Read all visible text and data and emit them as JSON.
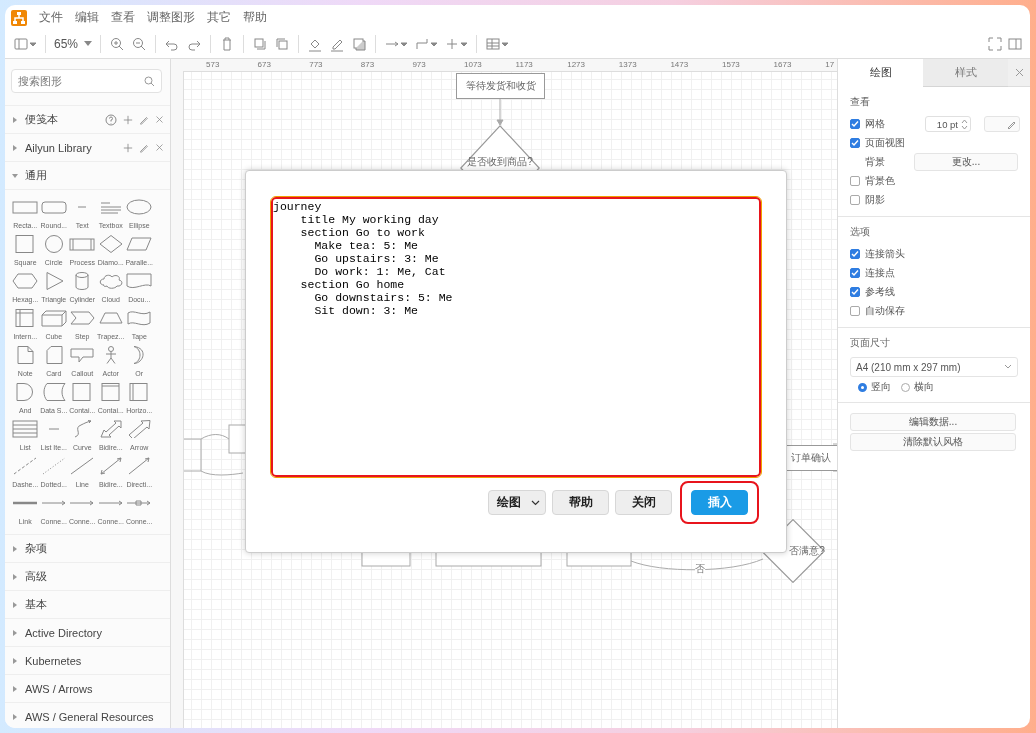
{
  "menu": [
    "文件",
    "编辑",
    "查看",
    "调整图形",
    "其它",
    "帮助"
  ],
  "toolbar": {
    "zoom": "65%"
  },
  "sidebar": {
    "search": {
      "placeholder": "搜索图形"
    },
    "sections": [
      {
        "kind": "scratchpad",
        "title": "便笺本",
        "expanded": false
      },
      {
        "kind": "library",
        "title": "Ailyun Library",
        "expanded": false
      },
      {
        "kind": "palette",
        "title": "通用",
        "expanded": true,
        "shapes": [
          "Recta...",
          "Round...",
          "Text",
          "Textbox",
          "Ellipse",
          "Square",
          "Circle",
          "Process",
          "Diamo...",
          "Paralle...",
          "Hexag...",
          "Triangle",
          "Cylinder",
          "Cloud",
          "Docu...",
          "Intern...",
          "Cube",
          "Step",
          "Trapez...",
          "Tape",
          "Note",
          "Card",
          "Callout",
          "Actor",
          "Or",
          "And",
          "Data S...",
          "Contai...",
          "Contai...",
          "Horizo...",
          "List",
          "List Ite...",
          "Curve",
          "Bidire...",
          "Arrow",
          "Dashe...",
          "Dotted...",
          "Line",
          "Bidire...",
          "Directi...",
          "Link",
          "Conne...",
          "Conne...",
          "Conne...",
          "Conne..."
        ]
      },
      {
        "kind": "palette",
        "title": "杂项",
        "expanded": false
      },
      {
        "kind": "palette",
        "title": "高级",
        "expanded": false
      },
      {
        "kind": "palette",
        "title": "基本",
        "expanded": false
      },
      {
        "kind": "palette",
        "title": "Active Directory",
        "expanded": false
      },
      {
        "kind": "palette",
        "title": "Kubernetes",
        "expanded": false
      },
      {
        "kind": "palette",
        "title": "AWS / Arrows",
        "expanded": false
      },
      {
        "kind": "palette",
        "title": "AWS / General Resources",
        "expanded": false
      }
    ]
  },
  "canvas": {
    "ruler": [
      "573",
      "673",
      "773",
      "873",
      "973",
      "1073",
      "1173",
      "1273",
      "1373",
      "1473",
      "1573",
      "1673",
      "17"
    ],
    "nodes": [
      {
        "kind": "process",
        "label": "等待发货和收货"
      },
      {
        "kind": "decision",
        "label": "是否收到商品?"
      },
      {
        "kind": "process",
        "label": "订单确认"
      },
      {
        "kind": "decision",
        "label": "否满意?"
      }
    ],
    "edge_labels": [
      "否"
    ]
  },
  "panel": {
    "tabs": [
      {
        "label": "绘图",
        "selected": true
      },
      {
        "label": "样式",
        "selected": false
      }
    ],
    "sections": [
      {
        "title": "查看",
        "options": [
          {
            "kind": "checkbox",
            "label": "网格",
            "checked": true,
            "spinner": "10 pt"
          },
          {
            "kind": "checkbox",
            "label": "页面视图",
            "checked": true
          },
          {
            "kind": "button",
            "label": "背景",
            "button": "更改..."
          },
          {
            "kind": "checkbox",
            "label": "背景色",
            "checked": false
          },
          {
            "kind": "checkbox",
            "label": "阴影",
            "checked": false
          }
        ]
      },
      {
        "title": "选项",
        "options": [
          {
            "kind": "checkbox",
            "label": "连接箭头",
            "checked": true
          },
          {
            "kind": "checkbox",
            "label": "连接点",
            "checked": true
          },
          {
            "kind": "checkbox",
            "label": "参考线",
            "checked": true
          },
          {
            "kind": "checkbox",
            "label": "自动保存",
            "checked": false
          }
        ]
      },
      {
        "title": "页面尺寸",
        "options": [
          {
            "kind": "select",
            "value": "A4 (210 mm x 297 mm)"
          },
          {
            "kind": "radios",
            "choices": [
              {
                "label": "竖向",
                "selected": true
              },
              {
                "label": "横向",
                "selected": false
              }
            ]
          }
        ]
      }
    ],
    "buttons": [
      "编辑数据...",
      "清除默认风格"
    ]
  },
  "dialog": {
    "editor": {
      "lines": [
        "journey",
        "    title My working day",
        "    section Go to work",
        "      Make tea: 5: Me",
        "      Go upstairs: 3: Me",
        "      Do work: 1: Me, Cat",
        "    section Go home",
        "      Go downstairs: 5: Me",
        "      Sit down: 3: Me"
      ]
    },
    "diagram_type": "绘图",
    "buttons": [
      {
        "kind": "default",
        "label": "帮助",
        "highlighted": false
      },
      {
        "kind": "default",
        "label": "关闭",
        "highlighted": false
      },
      {
        "kind": "primary",
        "label": "插入",
        "highlighted": true
      }
    ]
  }
}
